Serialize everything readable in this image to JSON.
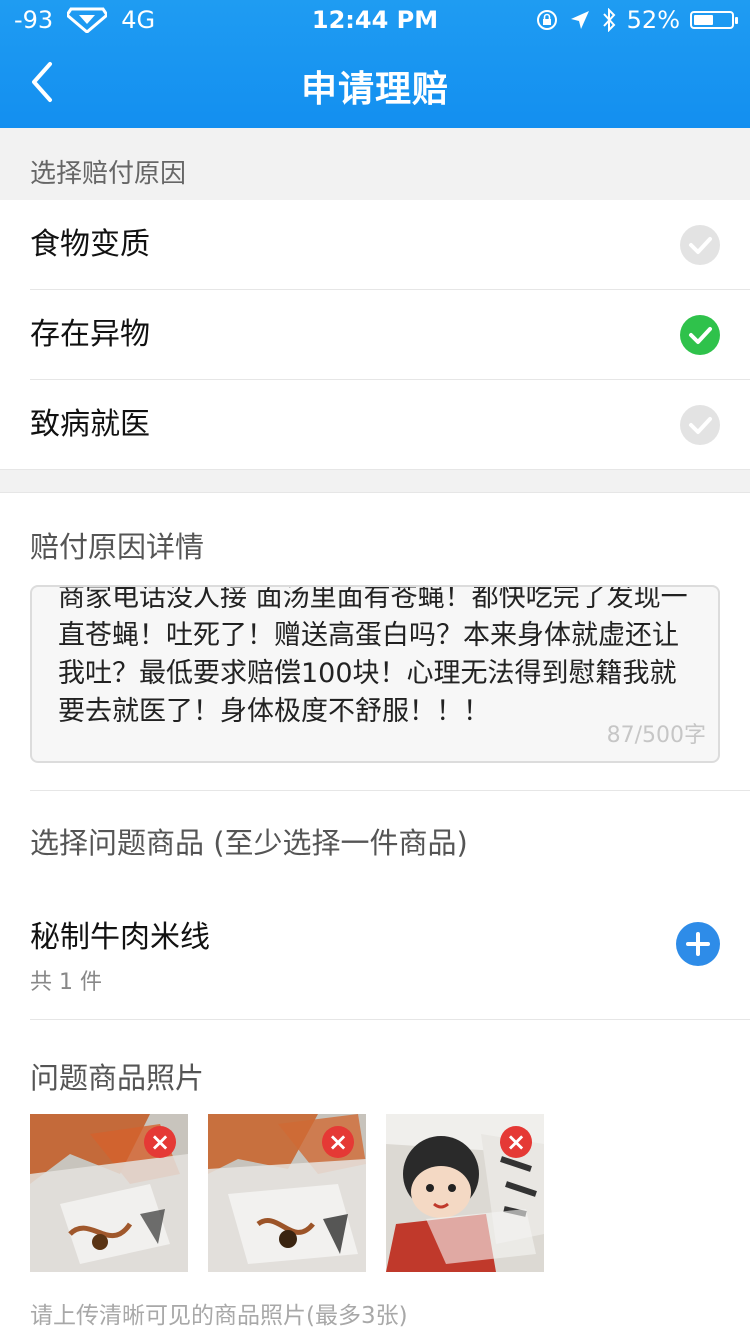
{
  "status_bar": {
    "signal": "-93",
    "network": "4G",
    "time": "12:44 PM",
    "battery": "52%",
    "battery_level": 0.52
  },
  "header": {
    "title": "申请理赔"
  },
  "reasons": {
    "section_title": "选择赔付原因",
    "options": [
      {
        "label": "食物变质",
        "selected": false
      },
      {
        "label": "存在异物",
        "selected": true
      },
      {
        "label": "致病就医",
        "selected": false
      }
    ]
  },
  "details": {
    "section_title": "赔付原因详情",
    "text": "商家电话没人接 面汤里面有苍蝇！都快吃完了发现一直苍蝇！吐死了！赠送高蛋白吗？本来身体就虚还让我吐？最低要求赔偿100块！心理无法得到慰籍我就要去就医了！身体极度不舒服！！！",
    "count": "87/500字"
  },
  "products": {
    "section_title": "选择问题商品 (至少选择一件商品)",
    "item_name": "秘制牛肉米线",
    "item_count": "共 1 件"
  },
  "photos": {
    "section_title": "问题商品照片",
    "hint": "请上传清晰可见的商品照片(最多3张)"
  },
  "colors": {
    "header": "#1f9cf2",
    "check_selected": "#2fc24b",
    "check_unselected": "#e3e3e3",
    "add_button": "#2e8ce8",
    "delete_badge": "#e53935"
  }
}
